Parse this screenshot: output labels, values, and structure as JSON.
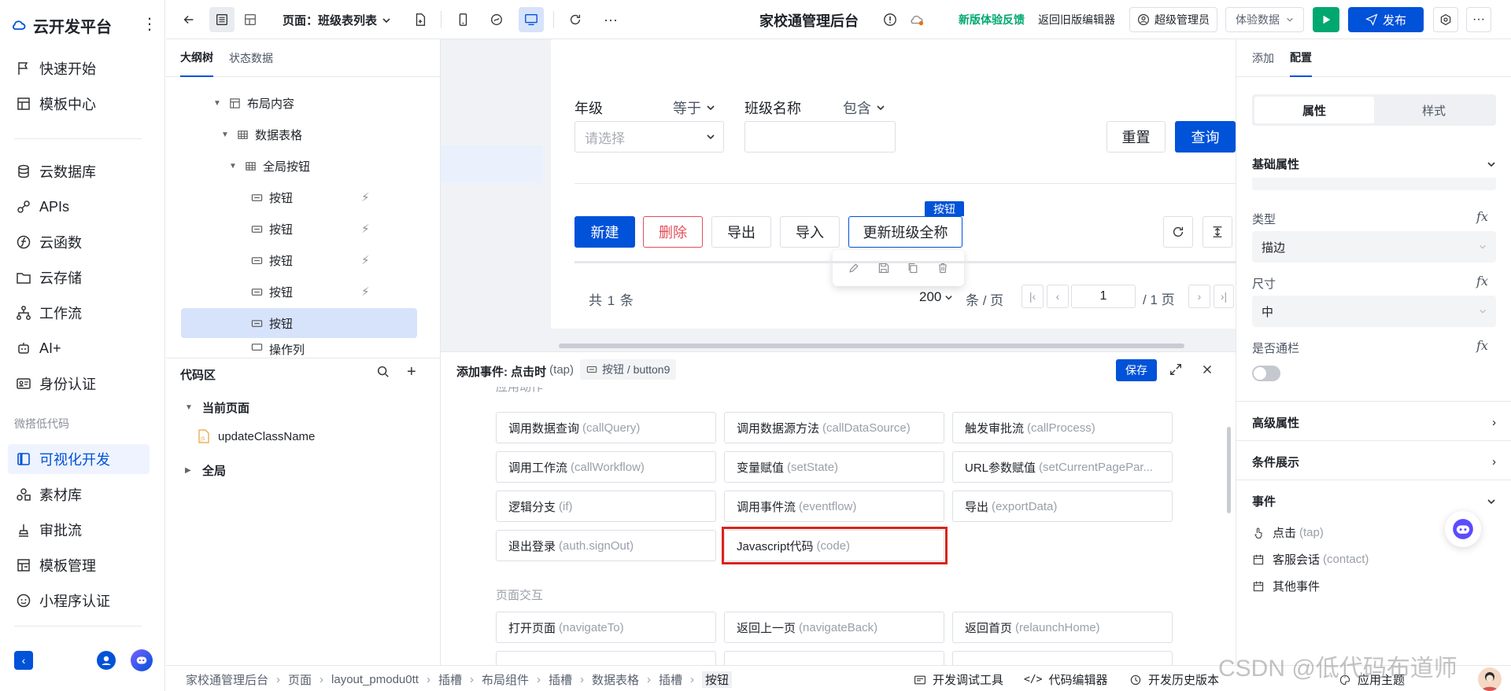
{
  "brand": {
    "name": "云开发平台"
  },
  "nav": {
    "items": [
      {
        "label": "快速开始",
        "icon": "flag-icon"
      },
      {
        "label": "模板中心",
        "icon": "template-icon"
      },
      {
        "label": "云数据库",
        "icon": "database-icon"
      },
      {
        "label": "APIs",
        "icon": "api-icon"
      },
      {
        "label": "云函数",
        "icon": "function-icon"
      },
      {
        "label": "云存储",
        "icon": "folder-icon"
      },
      {
        "label": "工作流",
        "icon": "workflow-icon"
      },
      {
        "label": "AI+",
        "icon": "robot-icon"
      },
      {
        "label": "身份认证",
        "icon": "id-card-icon"
      }
    ],
    "group_label": "微搭低代码",
    "lowcode_items": [
      {
        "label": "可视化开发",
        "icon": "visual-dev-icon"
      },
      {
        "label": "素材库",
        "icon": "assets-icon"
      },
      {
        "label": "审批流",
        "icon": "approval-icon"
      },
      {
        "label": "模板管理",
        "icon": "template-manage-icon"
      },
      {
        "label": "小程序认证",
        "icon": "miniprogram-icon"
      }
    ]
  },
  "topbar": {
    "page_selector": "页面：班级表列表",
    "app_title": "家校通管理后台",
    "feedback": "新版体验反馈",
    "back_old": "返回旧版编辑器",
    "user": "超级管理员",
    "data_mode": "体验数据",
    "publish": "发布"
  },
  "outline": {
    "tabs": [
      "大纲树",
      "状态数据"
    ],
    "nodes": [
      {
        "label": "布局内容"
      },
      {
        "label": "数据表格"
      },
      {
        "label": "全局按钮"
      },
      {
        "label": "按钮"
      },
      {
        "label": "按钮"
      },
      {
        "label": "按钮"
      },
      {
        "label": "按钮"
      },
      {
        "label": "按钮"
      },
      {
        "label": "操作列"
      }
    ]
  },
  "code": {
    "title": "代码区",
    "current_page": "当前页面",
    "file": "updateClassName",
    "global": "全局"
  },
  "canvas": {
    "filter": {
      "grade_label": "年级",
      "grade_op": "等于",
      "grade_placeholder": "请选择",
      "class_label": "班级名称",
      "class_op": "包含",
      "reset": "重置",
      "query": "查询"
    },
    "buttons": {
      "new": "新建",
      "delete": "删除",
      "export": "导出",
      "import": "导入",
      "update": "更新班级全称",
      "selected_tag": "按钮"
    },
    "pagination": {
      "total": "共 1 条",
      "page_size": "200",
      "per_page": "条 / 页",
      "current": "1",
      "total_pages": "/ 1 页"
    }
  },
  "event": {
    "title": "添加事件: 点击时",
    "title_en": "(tap)",
    "target": "按钮 / button9",
    "save": "保存",
    "section1": "应用动作",
    "actions": [
      {
        "cn": "调用数据查询",
        "en": "(callQuery)"
      },
      {
        "cn": "调用数据源方法",
        "en": "(callDataSource)"
      },
      {
        "cn": "触发审批流",
        "en": "(callProcess)"
      },
      {
        "cn": "调用工作流",
        "en": "(callWorkflow)"
      },
      {
        "cn": "变量赋值",
        "en": "(setState)"
      },
      {
        "cn": "URL参数赋值",
        "en": "(setCurrentPagePar..."
      },
      {
        "cn": "逻辑分支",
        "en": "(if)"
      },
      {
        "cn": "调用事件流",
        "en": "(eventflow)"
      },
      {
        "cn": "导出",
        "en": "(exportData)"
      },
      {
        "cn": "退出登录",
        "en": "(auth.signOut)"
      },
      {
        "cn": "Javascript代码",
        "en": "(code)"
      }
    ],
    "section2": "页面交互",
    "page_actions": [
      {
        "cn": "打开页面",
        "en": "(navigateTo)"
      },
      {
        "cn": "返回上一页",
        "en": "(navigateBack)"
      },
      {
        "cn": "返回首页",
        "en": "(relaunchHome)"
      }
    ]
  },
  "right": {
    "tabs": [
      "添加",
      "配置"
    ],
    "segments": [
      "属性",
      "样式"
    ],
    "basic": "基础属性",
    "type_label": "类型",
    "type_value": "描边",
    "size_label": "尺寸",
    "size_value": "中",
    "block_label": "是否通栏",
    "advanced": "高级属性",
    "conditional": "条件展示",
    "events": "事件",
    "event_items": [
      "点击",
      "客服会话",
      "其他事件"
    ],
    "event_items_en": [
      "(tap)",
      "(contact)",
      ""
    ]
  },
  "bottom": {
    "crumbs": [
      "家校通管理后台",
      "页面",
      "layout_pmodu0tt",
      "插槽",
      "布局组件",
      "插槽",
      "数据表格",
      "插槽",
      "按钮"
    ],
    "tools": [
      "开发调试工具",
      "代码编辑器",
      "开发历史版本",
      "应用主题"
    ]
  },
  "watermark": "CSDN @低代码布道师",
  "colors": {
    "primary": "#0052d9",
    "danger": "#e34d59",
    "success": "#00a870",
    "highlight_box": "#d9241b"
  }
}
